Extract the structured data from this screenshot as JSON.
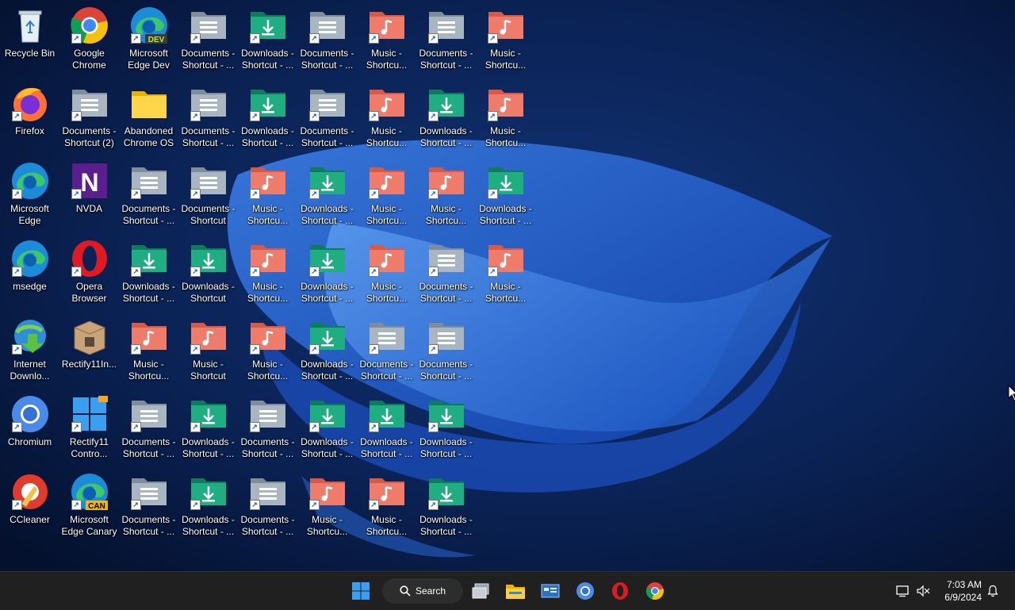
{
  "desktop": {
    "icons": [
      {
        "label": "Recycle Bin",
        "icon": "recycle-bin-icon",
        "shortcut": false
      },
      {
        "label": "Google\nChrome",
        "icon": "chrome-icon",
        "shortcut": true
      },
      {
        "label": "Microsoft\nEdge Dev",
        "icon": "edge-dev-icon",
        "badge": "DEV",
        "shortcut": true
      },
      {
        "label": "Documents -\nShortcut - ...",
        "icon": "documents-folder-icon",
        "shortcut": true
      },
      {
        "label": "Downloads -\nShortcut - ...",
        "icon": "downloads-folder-icon",
        "shortcut": true
      },
      {
        "label": "Documents -\nShortcut - ...",
        "icon": "documents-folder-icon",
        "shortcut": true
      },
      {
        "label": "Music -\nShortcu...",
        "icon": "music-folder-icon",
        "shortcut": true
      },
      {
        "label": "Documents -\nShortcut - ...",
        "icon": "documents-folder-icon",
        "shortcut": true
      },
      {
        "label": "Music -\nShortcu...",
        "icon": "music-folder-icon",
        "shortcut": true
      },
      {
        "label": "Firefox",
        "icon": "firefox-icon",
        "shortcut": true
      },
      {
        "label": "Documents -\nShortcut (2)",
        "icon": "documents-folder-icon",
        "shortcut": true
      },
      {
        "label": "Abandoned\nChrome OS",
        "icon": "folder-icon",
        "shortcut": false
      },
      {
        "label": "Documents -\nShortcut - ...",
        "icon": "documents-folder-icon",
        "shortcut": true
      },
      {
        "label": "Downloads -\nShortcut - ...",
        "icon": "downloads-folder-icon",
        "shortcut": true
      },
      {
        "label": "Documents -\nShortcut - ...",
        "icon": "documents-folder-icon",
        "shortcut": true
      },
      {
        "label": "Music -\nShortcu...",
        "icon": "music-folder-icon",
        "shortcut": true
      },
      {
        "label": "Downloads -\nShortcut - ...",
        "icon": "downloads-folder-icon",
        "shortcut": true
      },
      {
        "label": "Music -\nShortcu...",
        "icon": "music-folder-icon",
        "shortcut": true
      },
      {
        "label": "Microsoft\nEdge",
        "icon": "edge-icon",
        "shortcut": true
      },
      {
        "label": "NVDA",
        "icon": "nvda-icon",
        "shortcut": true
      },
      {
        "label": "Documents -\nShortcut - ...",
        "icon": "documents-folder-icon",
        "shortcut": true
      },
      {
        "label": "Documents -\nShortcut",
        "icon": "documents-folder-icon",
        "shortcut": true
      },
      {
        "label": "Music -\nShortcu...",
        "icon": "music-folder-icon",
        "shortcut": true
      },
      {
        "label": "Downloads -\nShortcut - ...",
        "icon": "downloads-folder-icon",
        "shortcut": true
      },
      {
        "label": "Music -\nShortcu...",
        "icon": "music-folder-icon",
        "shortcut": true
      },
      {
        "label": "Music -\nShortcu...",
        "icon": "music-folder-icon",
        "shortcut": true
      },
      {
        "label": "Downloads -\nShortcut - ...",
        "icon": "downloads-folder-icon",
        "shortcut": true
      },
      {
        "label": "msedge",
        "icon": "edge-icon",
        "shortcut": true
      },
      {
        "label": "Opera\nBrowser",
        "icon": "opera-icon",
        "shortcut": true
      },
      {
        "label": "Downloads -\nShortcut - ...",
        "icon": "downloads-folder-icon",
        "shortcut": true
      },
      {
        "label": "Downloads -\nShortcut",
        "icon": "downloads-folder-icon",
        "shortcut": true
      },
      {
        "label": "Music -\nShortcu...",
        "icon": "music-folder-icon",
        "shortcut": true
      },
      {
        "label": "Downloads -\nShortcut - ...",
        "icon": "downloads-folder-icon",
        "shortcut": true
      },
      {
        "label": "Music -\nShortcu...",
        "icon": "music-folder-icon",
        "shortcut": true
      },
      {
        "label": "Documents -\nShortcut - ...",
        "icon": "documents-folder-icon",
        "shortcut": true
      },
      {
        "label": "Music -\nShortcu...",
        "icon": "music-folder-icon",
        "shortcut": true
      },
      {
        "label": "Internet\nDownlo...",
        "icon": "internet-download-manager-icon",
        "shortcut": true
      },
      {
        "label": "Rectify11In...",
        "icon": "installer-box-icon",
        "shortcut": false
      },
      {
        "label": "Music -\nShortcu...",
        "icon": "music-folder-icon",
        "shortcut": true
      },
      {
        "label": "Music -\nShortcut",
        "icon": "music-folder-icon",
        "shortcut": true
      },
      {
        "label": "Music -\nShortcu...",
        "icon": "music-folder-icon",
        "shortcut": true
      },
      {
        "label": "Downloads -\nShortcut - ...",
        "icon": "downloads-folder-icon",
        "shortcut": true
      },
      {
        "label": "Documents -\nShortcut - ...",
        "icon": "documents-folder-icon",
        "shortcut": true
      },
      {
        "label": "Documents -\nShortcut - ...",
        "icon": "documents-folder-icon",
        "shortcut": true
      },
      {
        "label": "Chromium",
        "icon": "chromium-icon",
        "shortcut": true
      },
      {
        "label": "Rectify11\nContro...",
        "icon": "rectify11-control-icon",
        "shortcut": true
      },
      {
        "label": "Documents -\nShortcut - ...",
        "icon": "documents-folder-icon",
        "shortcut": true
      },
      {
        "label": "Downloads -\nShortcut - ...",
        "icon": "downloads-folder-icon",
        "shortcut": true
      },
      {
        "label": "Documents -\nShortcut - ...",
        "icon": "documents-folder-icon",
        "shortcut": true
      },
      {
        "label": "Downloads -\nShortcut - ...",
        "icon": "downloads-folder-icon",
        "shortcut": true
      },
      {
        "label": "Downloads -\nShortcut - ...",
        "icon": "downloads-folder-icon",
        "shortcut": true
      },
      {
        "label": "Downloads -\nShortcut - ...",
        "icon": "downloads-folder-icon",
        "shortcut": true
      },
      {
        "label": "CCleaner",
        "icon": "ccleaner-icon",
        "shortcut": true
      },
      {
        "label": "Microsoft\nEdge Canary",
        "icon": "edge-canary-icon",
        "badge": "CAN",
        "shortcut": true
      },
      {
        "label": "Documents -\nShortcut - ...",
        "icon": "documents-folder-icon",
        "shortcut": true
      },
      {
        "label": "Downloads -\nShortcut - ...",
        "icon": "downloads-folder-icon",
        "shortcut": true
      },
      {
        "label": "Documents -\nShortcut - ...",
        "icon": "documents-folder-icon",
        "shortcut": true
      },
      {
        "label": "Music -\nShortcu...",
        "icon": "music-folder-icon",
        "shortcut": true
      },
      {
        "label": "Music -\nShortcu...",
        "icon": "music-folder-icon",
        "shortcut": true
      },
      {
        "label": "Downloads -\nShortcut - ...",
        "icon": "downloads-folder-icon",
        "shortcut": true
      }
    ]
  },
  "taskbar": {
    "search_label": "Search",
    "apps": [
      {
        "name": "task-view-icon"
      },
      {
        "name": "file-explorer-icon"
      },
      {
        "name": "control-panel-icon"
      },
      {
        "name": "chromium-icon"
      },
      {
        "name": "opera-icon"
      },
      {
        "name": "chrome-icon"
      }
    ],
    "clock": {
      "time": "7:03 AM",
      "date": "6/9/2024"
    }
  },
  "colors": {
    "taskbar": "#202020",
    "wallpaper": "#0a2350",
    "accent": "#2f7be0"
  }
}
